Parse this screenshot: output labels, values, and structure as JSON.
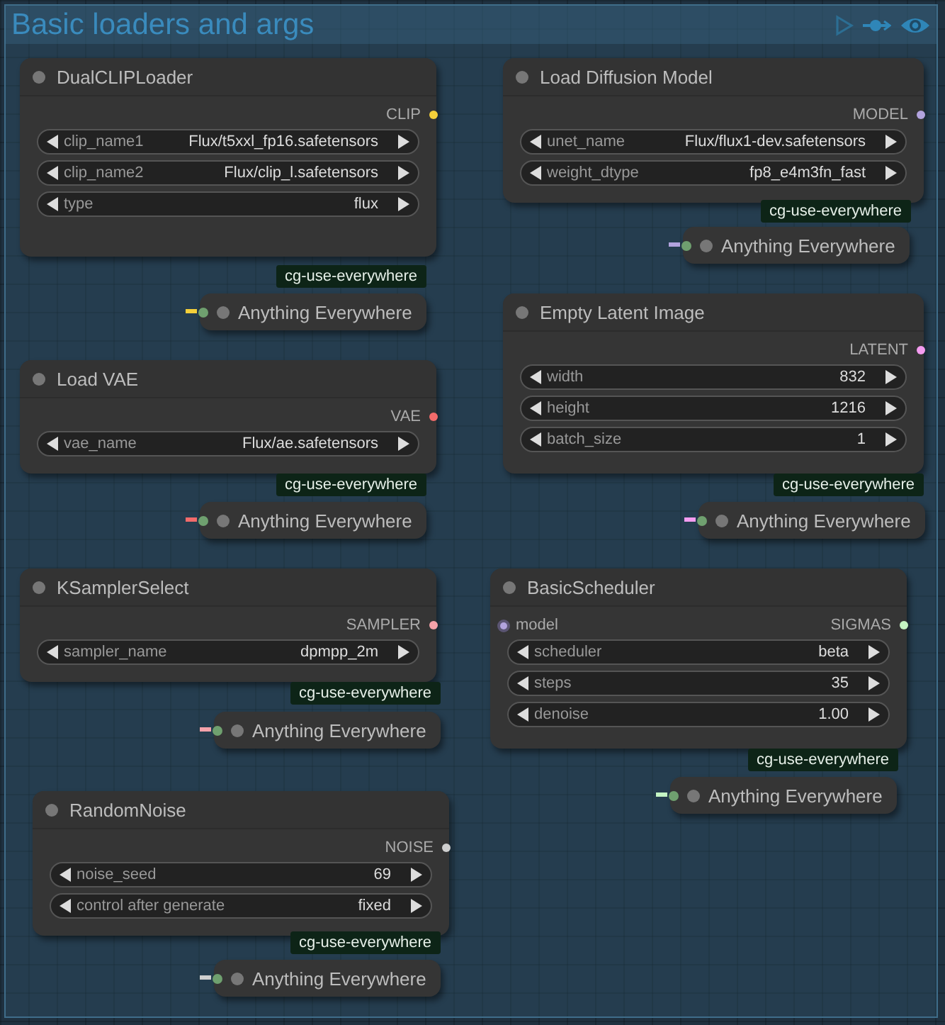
{
  "group": {
    "title": "Basic loaders and args"
  },
  "nodes": [
    {
      "title": "DualCLIPLoader",
      "output": {
        "label": "CLIP",
        "color": "#f3cf3a"
      },
      "widgets": [
        {
          "name": "clip_name1",
          "value": "Flux/t5xxl_fp16.safetensors"
        },
        {
          "name": "clip_name2",
          "value": "Flux/clip_l.safetensors"
        },
        {
          "name": "type",
          "value": "flux"
        }
      ],
      "tag": "cg-use-everywhere",
      "receiver": "Anything Everywhere"
    },
    {
      "title": "Load Diffusion Model",
      "output": {
        "label": "MODEL",
        "color": "#b2a3de"
      },
      "widgets": [
        {
          "name": "unet_name",
          "value": "Flux/flux1-dev.safetensors"
        },
        {
          "name": "weight_dtype",
          "value": "fp8_e4m3fn_fast"
        }
      ],
      "tag": "cg-use-everywhere",
      "receiver": "Anything Everywhere"
    },
    {
      "title": "Load VAE",
      "output": {
        "label": "VAE",
        "color": "#f26b6b"
      },
      "widgets": [
        {
          "name": "vae_name",
          "value": "Flux/ae.safetensors"
        }
      ],
      "tag": "cg-use-everywhere",
      "receiver": "Anything Everywhere"
    },
    {
      "title": "Empty Latent Image",
      "output": {
        "label": "LATENT",
        "color": "#f49cf0"
      },
      "widgets": [
        {
          "name": "width",
          "value": "832"
        },
        {
          "name": "height",
          "value": "1216"
        },
        {
          "name": "batch_size",
          "value": "1"
        }
      ],
      "tag": "cg-use-everywhere",
      "receiver": "Anything Everywhere"
    },
    {
      "title": "KSamplerSelect",
      "output": {
        "label": "SAMPLER",
        "color": "#f4a2aa"
      },
      "widgets": [
        {
          "name": "sampler_name",
          "value": "dpmpp_2m"
        }
      ],
      "tag": "cg-use-everywhere",
      "receiver": "Anything Everywhere"
    },
    {
      "title": "BasicScheduler",
      "inputs": [
        {
          "label": "model",
          "color": "#b2a3de"
        }
      ],
      "output": {
        "label": "SIGMAS",
        "color": "#c4f5c4"
      },
      "widgets": [
        {
          "name": "scheduler",
          "value": "beta"
        },
        {
          "name": "steps",
          "value": "35"
        },
        {
          "name": "denoise",
          "value": "1.00"
        }
      ],
      "tag": "cg-use-everywhere",
      "receiver": "Anything Everywhere"
    },
    {
      "title": "RandomNoise",
      "output": {
        "label": "NOISE",
        "color": "#cfcfcf"
      },
      "widgets": [
        {
          "name": "noise_seed",
          "value": "69"
        },
        {
          "name": "control after generate",
          "value": "fixed"
        }
      ],
      "tag": "cg-use-everywhere",
      "receiver": "Anything Everywhere"
    }
  ]
}
